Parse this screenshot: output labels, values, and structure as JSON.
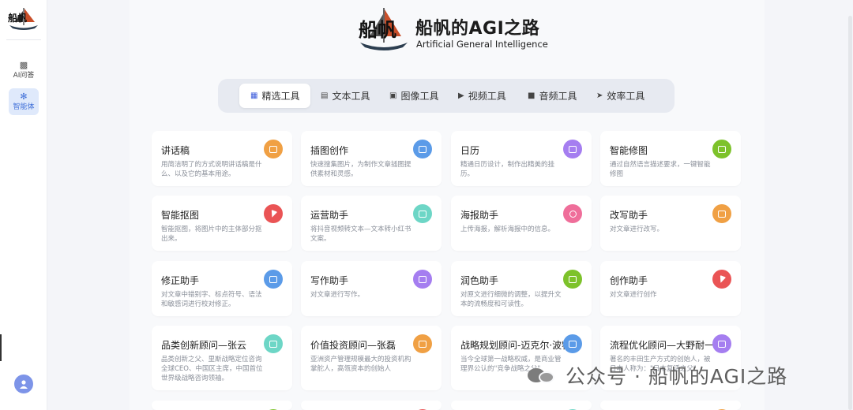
{
  "sidebar": {
    "logo_name": "boat-logo",
    "items": [
      {
        "label": "AI问答",
        "icon": "chat-icon"
      },
      {
        "label": "智能体",
        "icon": "agent-icon",
        "active": true
      }
    ],
    "avatar_icon": "user-icon"
  },
  "brand": {
    "logo_text": "船帆",
    "title": "船帆的AGI之路",
    "subtitle": "Artificial General Intelligence"
  },
  "tabs": [
    {
      "label": "精选工具",
      "icon": "grid-icon",
      "active": true
    },
    {
      "label": "文本工具",
      "icon": "document-icon"
    },
    {
      "label": "图像工具",
      "icon": "image-icon"
    },
    {
      "label": "视频工具",
      "icon": "video-icon"
    },
    {
      "label": "音频工具",
      "icon": "radio-icon"
    },
    {
      "label": "效率工具",
      "icon": "rocket-icon"
    }
  ],
  "cards": [
    {
      "title": "讲话稿",
      "desc": "用简洁明了的方式说明讲话稿是什么、以及它的基本用途。",
      "icon": "image-icon",
      "color": "#f0a044"
    },
    {
      "title": "插图创作",
      "desc": "快速搜集图片，为制作文章插图提供素材和灵感。",
      "icon": "copy-icon",
      "color": "#5b9be8"
    },
    {
      "title": "日历",
      "desc": "精通日历设计，制作出精美的挂历。",
      "icon": "pencil-icon",
      "color": "#a57ef0"
    },
    {
      "title": "智能修图",
      "desc": "通过自然语言描述要求，一键智能修图",
      "icon": "video-icon",
      "color": "#7dc22b"
    },
    {
      "title": "智能抠图",
      "desc": "智能抠图，将图片中的主体部分抠出来。",
      "icon": "bolt-icon",
      "color": "#ea5455"
    },
    {
      "title": "运营助手",
      "desc": "将抖音视频转文本—文本转小红书文案。",
      "icon": "image-icon",
      "color": "#6dd6c6"
    },
    {
      "title": "海报助手",
      "desc": "上传海报，解析海报中的信息。",
      "icon": "tag-icon",
      "color": "#ef6e9a"
    },
    {
      "title": "改写助手",
      "desc": "对文章进行改写。",
      "icon": "image-icon",
      "color": "#f0a044"
    },
    {
      "title": "修正助手",
      "desc": "对文章中错别字、标点符号、语法和敏感词进行校对修正。",
      "icon": "copy-icon",
      "color": "#5b9be8"
    },
    {
      "title": "写作助手",
      "desc": "对文章进行写作。",
      "icon": "pencil-icon",
      "color": "#a57ef0"
    },
    {
      "title": "润色助手",
      "desc": "对原文进行细微的调整，以提升文本的流畅度和可读性。",
      "icon": "video-icon",
      "color": "#7dc22b"
    },
    {
      "title": "创作助手",
      "desc": "对文章进行创作",
      "icon": "bolt-icon",
      "color": "#ea5455"
    },
    {
      "title": "品类创新顾问—张云",
      "desc": "品类创新之父、里斯战略定位咨询全球CEO、中国区主席，中国首位世界级战略咨询领袖。",
      "icon": "image-icon",
      "color": "#6dd6c6"
    },
    {
      "title": "价值投资顾问—张磊",
      "desc": "亚洲资产管理规模最大的投资机构掌舵人，高瓴资本的创始人",
      "icon": "image-icon",
      "color": "#f0a044"
    },
    {
      "title": "战略规划顾问-迈克尔·波特",
      "desc": "当今全球第一战略权威，是商业管理界公认的\"竞争战略之父\"",
      "icon": "copy-icon",
      "color": "#5b9be8"
    },
    {
      "title": "流程优化顾问—大野耐一",
      "desc": "著名的丰田生产方式的创始人，被日本人称为：\"日本复活之父\"",
      "icon": "pencil-icon",
      "color": "#a57ef0"
    }
  ],
  "partial_row_colors": [
    "#7dc22b",
    "#ea5455",
    "#6dd6c6",
    "#f0a044"
  ],
  "watermark": {
    "icon": "wechat-icon",
    "text": "公众号 · 船帆的AGI之路"
  }
}
